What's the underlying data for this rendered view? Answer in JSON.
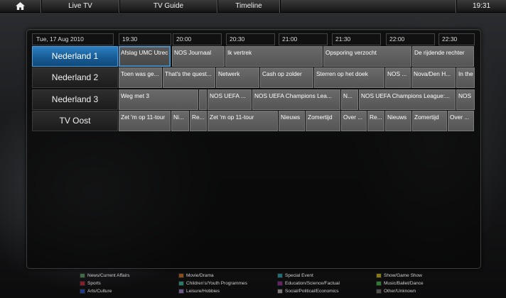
{
  "topbar": {
    "home_icon": "home-icon",
    "live_tv": "Live TV",
    "tv_guide": "TV Guide",
    "timeline": "Timeline",
    "clock": "19:31"
  },
  "guide": {
    "date": "Tue, 17 Aug 2010",
    "times": [
      "19:30",
      "20:00",
      "20:30",
      "21:00",
      "21:30",
      "22:00",
      "22:30"
    ],
    "channels": [
      {
        "name": "Nederland 1",
        "active": true,
        "programs": [
          "Afslag UMC Utrec",
          "NOS Journaal",
          "Ik vertrek",
          "Opsporing verzocht",
          "De rijdende rechter"
        ]
      },
      {
        "name": "Nederland 2",
        "active": false,
        "programs": [
          "Toen was ge...",
          "That's the quest...",
          "Netwerk",
          "Cash op zolder",
          "Sterren op het doek",
          "NOS ...",
          "Nova/Den H...",
          "In the"
        ]
      },
      {
        "name": "Nederland 3",
        "active": false,
        "programs": [
          "Weg met 3",
          "",
          "NOS UEFA ...",
          "NOS UEFA Champions Lea...",
          "N...",
          "NOS UEFA Champions League:...",
          "NOS"
        ]
      },
      {
        "name": "TV Oost",
        "active": false,
        "programs": [
          "Zet 'm op 11-tour",
          "Ni...",
          "Re...",
          "Zet 'm op 11-tour",
          "Nieuws",
          "Zomertijd",
          "Over ...",
          "Re...",
          "Nieuws",
          "Zomertijd",
          "Over ..."
        ]
      }
    ]
  },
  "legend": [
    {
      "label": "News/Current Affairs",
      "color": "#3f6b45"
    },
    {
      "label": "Movie/Drama",
      "color": "#8a4a1c"
    },
    {
      "label": "Special Event",
      "color": "#1f6f7a"
    },
    {
      "label": "Show/Game Show",
      "color": "#8a7a14"
    },
    {
      "label": "Sports",
      "color": "#8c1c2c"
    },
    {
      "label": "Children's/Youth Programmes",
      "color": "#2a7a6a"
    },
    {
      "label": "Education/Science/Factual",
      "color": "#6a1f6a"
    },
    {
      "label": "Music/Ballet/Dance",
      "color": "#2f7a34"
    },
    {
      "label": "Arts/Culture",
      "color": "#1c3c8a"
    },
    {
      "label": "Leisure/Hobbies",
      "color": "#6a5a8a"
    },
    {
      "label": "Social/Political/Economics",
      "color": "#777777"
    },
    {
      "label": "Other/Unknown",
      "color": "#505050"
    }
  ]
}
